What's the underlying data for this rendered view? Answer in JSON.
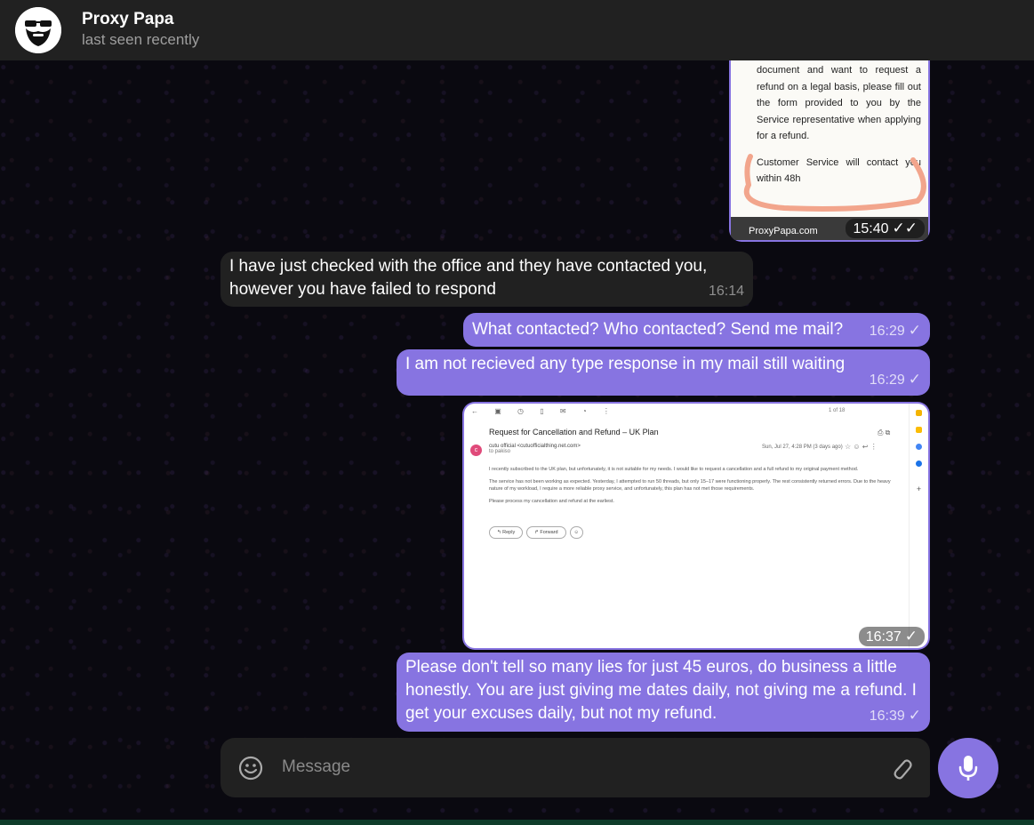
{
  "header": {
    "name": "Proxy Papa",
    "status": "last seen recently"
  },
  "messages": {
    "doc_image": {
      "text": "document and want to request a refund on a legal basis, please fill out the form provided to you by the Service representative when applying for a refund.",
      "highlight": "Customer Service will contact you within 48h",
      "url": "ProxyPapa.com",
      "time": "15:40"
    },
    "m1": {
      "text": "I have just checked with the office and they have contacted you, however you have failed to respond",
      "time": "16:14"
    },
    "m2": {
      "text": "What contacted? Who contacted? Send me mail?",
      "time": "16:29"
    },
    "m3": {
      "text": "I am not recieved any type response in my mail still waiting",
      "time": "16:29"
    },
    "mail_image": {
      "subject": "Request for Cancellation and Refund – UK Plan",
      "sender": "cutu official <cutuofficialthing.net.com>",
      "to": "to pakiso",
      "avatar_letter": "c",
      "date": "Sun, Jul 27, 4:28 PM (3 days ago)",
      "pager": "1 of 18",
      "body_1": "I recently subscribed to the UK plan, but unfortunately, it is not suitable for my needs. I would like to request a cancellation and a full refund to my original payment method.",
      "body_2": "The service has not been working as expected. Yesterday, I attempted to run 50 threads, but only 15–17 were functioning properly. The rest consistently returned errors. Due to the heavy nature of my workload, I require a more reliable proxy service, and unfortunately, this plan has not met those requirements.",
      "body_3": "Please process my cancellation and refund at the earliest.",
      "reply": "Reply",
      "forward": "Forward",
      "time": "16:37"
    },
    "m4": {
      "text": "Please don't tell so many lies for just 45 euros, do business a little honestly. You are just giving me dates daily, not giving me a refund. I get your excuses daily, but not my refund.",
      "time": "16:39"
    }
  },
  "composer": {
    "placeholder": "Message"
  },
  "icons": {
    "check": "✓",
    "double_check": "✓✓"
  },
  "colors": {
    "accent": "#8774e1",
    "incoming": "#212121",
    "header": "#212121"
  }
}
